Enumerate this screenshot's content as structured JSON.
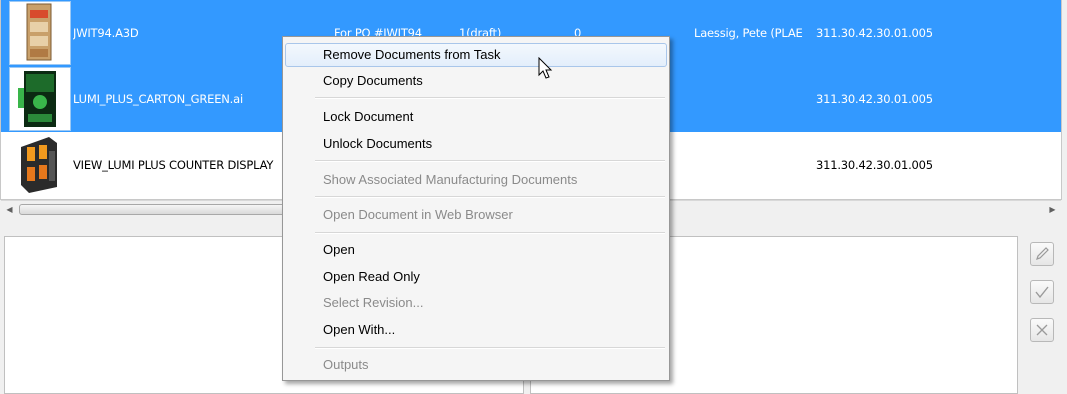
{
  "rows": [
    {
      "name": "JWIT94.A3D",
      "desc": "For PO #JWIT94",
      "rev": "1(draft)",
      "num": "0",
      "owner": "Laessig, Pete (PLAE",
      "code": "311.30.42.30.01.005",
      "selected": true,
      "thumb_icon": "3d-display-thumbnail-icon"
    },
    {
      "name": "LUMI_PLUS_CARTON_GREEN.ai",
      "desc": "",
      "rev": "",
      "num": "",
      "owner": "",
      "code": "311.30.42.30.01.005",
      "selected": true,
      "thumb_icon": "green-carton-thumbnail-icon"
    },
    {
      "name": "VIEW_LUMI PLUS COUNTER DISPLAY",
      "desc": "",
      "rev": "",
      "num": "",
      "owner": "",
      "code": "311.30.42.30.01.005",
      "selected": false,
      "thumb_icon": "counter-display-thumbnail-icon"
    }
  ],
  "menu": {
    "items": [
      {
        "label": "Remove Documents from Task",
        "enabled": true,
        "hover": true
      },
      {
        "label": "Copy Documents",
        "enabled": true
      },
      {
        "label": "Lock Document",
        "enabled": true
      },
      {
        "label": "Unlock Documents",
        "enabled": true
      },
      {
        "label": "Show Associated Manufacturing Documents",
        "enabled": false
      },
      {
        "label": "Open Document in Web Browser",
        "enabled": false
      },
      {
        "label": "Open",
        "enabled": true
      },
      {
        "label": "Open Read Only",
        "enabled": true
      },
      {
        "label": "Select Revision...",
        "enabled": false
      },
      {
        "label": "Open With...",
        "enabled": true
      },
      {
        "label": "Outputs",
        "enabled": false
      }
    ]
  },
  "side_buttons": [
    "edit-pencil-icon",
    "checkmark-icon",
    "close-x-icon"
  ],
  "colors": {
    "selection": "#3399ff",
    "menu_bg": "#f5f5f5",
    "disabled_text": "#8a8a8a",
    "hover_border": "#a9c6ea"
  }
}
